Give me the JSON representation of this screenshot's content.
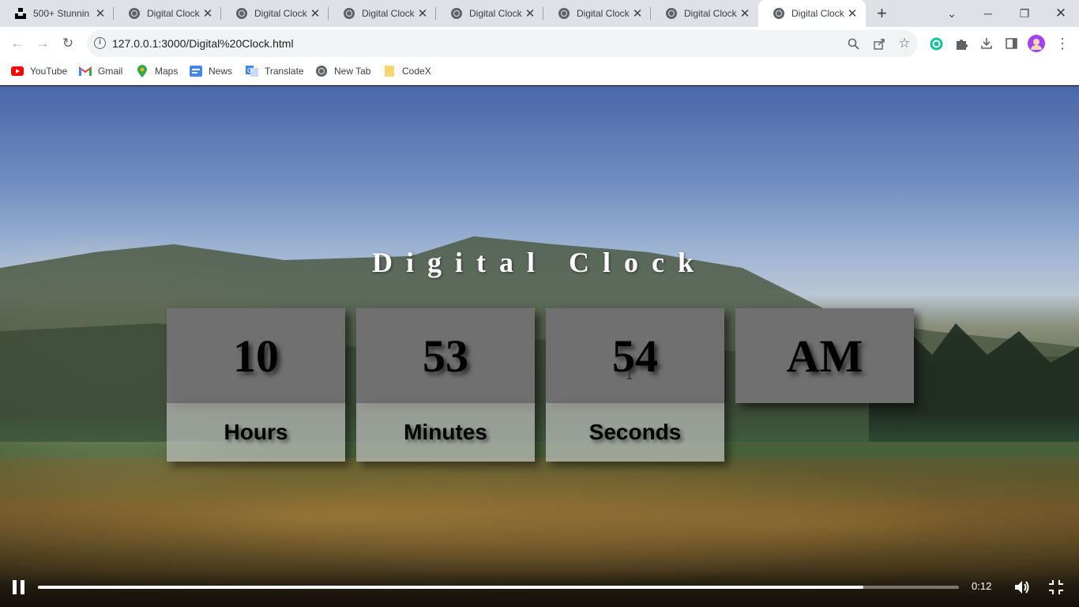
{
  "browser": {
    "tabs": [
      {
        "title": "500+ Stunnin",
        "favicon": "unsplash-icon"
      },
      {
        "title": "Digital Clock",
        "favicon": "globe-icon"
      },
      {
        "title": "Digital Clock",
        "favicon": "globe-icon"
      },
      {
        "title": "Digital Clock",
        "favicon": "globe-icon"
      },
      {
        "title": "Digital Clock",
        "favicon": "globe-icon"
      },
      {
        "title": "Digital Clock",
        "favicon": "globe-icon"
      },
      {
        "title": "Digital Clock",
        "favicon": "globe-icon"
      },
      {
        "title": "Digital Clock",
        "favicon": "globe-icon",
        "active": true
      }
    ],
    "url": "127.0.0.1:3000/Digital%20Clock.html",
    "bookmarks": [
      {
        "label": "YouTube",
        "icon": "youtube-icon"
      },
      {
        "label": "Gmail",
        "icon": "gmail-icon"
      },
      {
        "label": "Maps",
        "icon": "maps-icon"
      },
      {
        "label": "News",
        "icon": "news-icon"
      },
      {
        "label": "Translate",
        "icon": "translate-icon"
      },
      {
        "label": "New Tab",
        "icon": "globe-icon"
      },
      {
        "label": "CodeX",
        "icon": "folder-icon"
      }
    ]
  },
  "clock": {
    "title": "Digital Clock",
    "hours": {
      "value": "10",
      "label": "Hours"
    },
    "minutes": {
      "value": "53",
      "label": "Minutes"
    },
    "seconds": {
      "value": "54",
      "label": "Seconds"
    },
    "period": "AM"
  },
  "player": {
    "time": "0:12",
    "progress": 0.896
  },
  "colors": {
    "card_number_bg": "#707070",
    "card_label_bg": "#c8c8c8",
    "title_color": "#ffffff"
  }
}
